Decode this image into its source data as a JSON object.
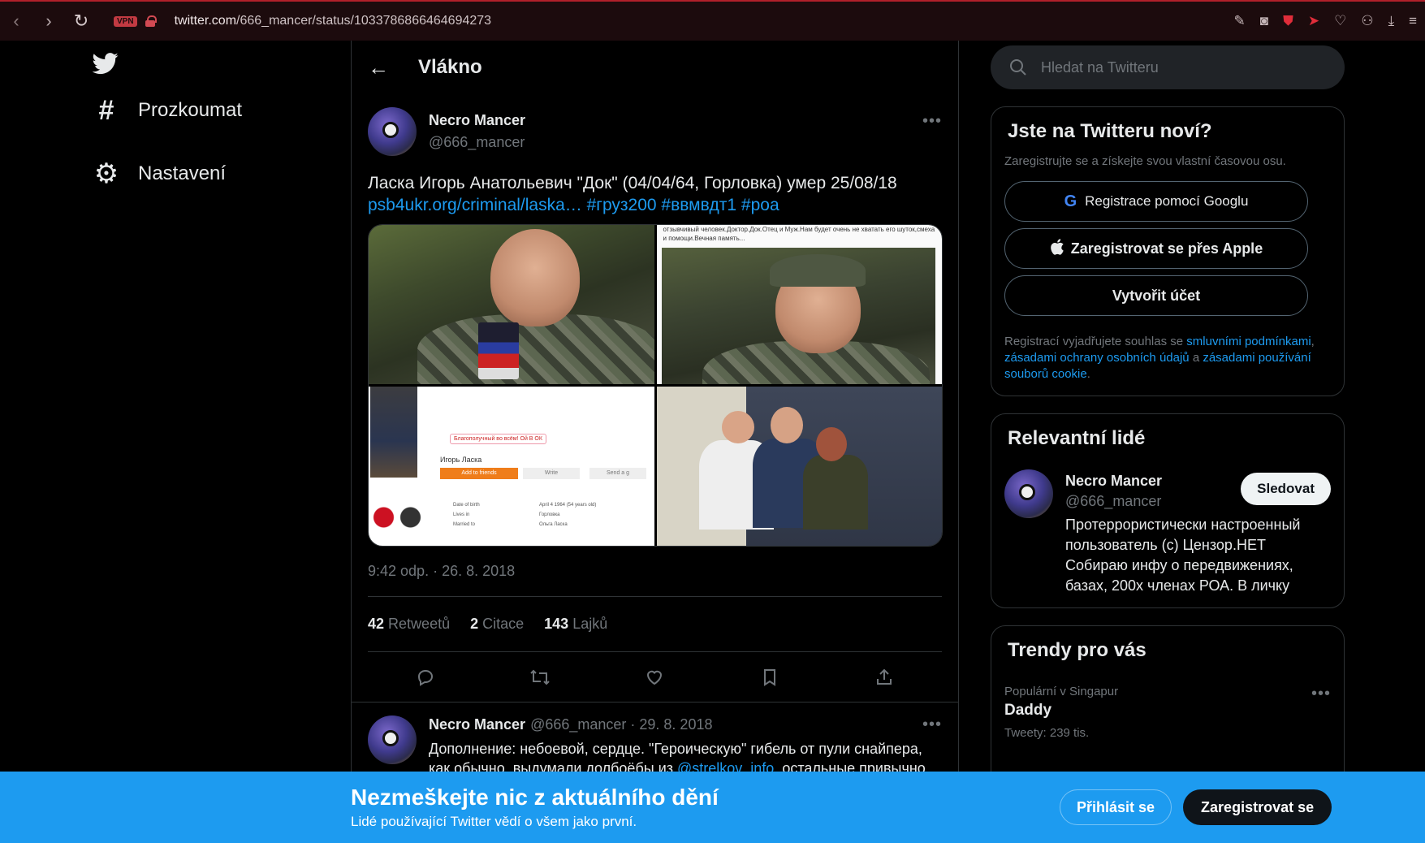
{
  "browser": {
    "vpn_label": "VPN",
    "url_host": "twitter.com",
    "url_path": "/666_mancer/status/1033786866464694273"
  },
  "nav": {
    "items": [
      {
        "label": "Prozkoumat",
        "icon": "hashtag-icon"
      },
      {
        "label": "Nastavení",
        "icon": "gear-icon"
      }
    ]
  },
  "main": {
    "title": "Vlákno"
  },
  "tweet": {
    "author_name": "Necro Mancer",
    "author_handle": "@666_mancer",
    "text": "Ласка Игорь Анатольевич \"Док\" (04/04/64, Горловка) умер 25/08/18",
    "link": "psb4ukr.org/criminal/laska…",
    "hashtags": "#груз200 #ввмвдт1 #роа",
    "media_caption_fragment": "отзывчивый человек.Доктор.Док.Отец и Муж.Нам будет очень не хватать его шуток,смеха и помощи.Вечная память...",
    "media_profile": {
      "badge": "Благополучный во всём! Ой В ОК",
      "name": "Игорь Ласка",
      "add_friends": "Add to friends",
      "write": "Write",
      "send": "Send a g",
      "fields": [
        "Date of birth",
        "Lives in",
        "Married to"
      ],
      "values": [
        "April 4 1964 (54 years old)",
        "Горловка",
        "Ольга Ласка"
      ]
    },
    "timestamp": "9:42 odp. · 26. 8. 2018",
    "stats": [
      {
        "count": "42",
        "label": "Retweetů"
      },
      {
        "count": "2",
        "label": "Citace"
      },
      {
        "count": "143",
        "label": "Lajků"
      }
    ]
  },
  "reply": {
    "author_name": "Necro Mancer",
    "meta": "@666_mancer · 29. 8. 2018",
    "text_line1": "Дополнение: небоевой, сердце. \"Героическую\" гибель от пули снайпера,",
    "text_line2_pre": "как обычно, выдумали долбоёбы из ",
    "text_line2_link": "@strelkov_info",
    "text_line2_post": ", остальные привычно"
  },
  "right": {
    "search_placeholder": "Hledat na Twitteru",
    "signup": {
      "title": "Jste na Twitteru noví?",
      "subtitle": "Zaregistrujte se a získejte svou vlastní časovou osu.",
      "google_btn": "Registrace pomocí Googlu",
      "apple_btn": "Zaregistrovat se přes Apple",
      "create_btn": "Vytvořit účet",
      "legal_pre": "Registrací vyjadřujete souhlas se ",
      "legal_link1": "smluvními podmínkami",
      "legal_mid": ", ",
      "legal_link2": "zásadami ochrany osobních údajů",
      "legal_and": " a ",
      "legal_link3": "zásadami používání souborů cookie",
      "legal_end": "."
    },
    "relevant": {
      "title": "Relevantní lidé",
      "name": "Necro Mancer",
      "handle": "@666_mancer",
      "follow": "Sledovat",
      "bio": "Протеррористически настроенный пользователь (c) Цензор.НЕТ Собираю инфу о передвижениях, базах, 200х членах РОА. В личку"
    },
    "trends": {
      "title": "Trendy pro vás",
      "location": "Populární v Singapur",
      "name": "Daddy",
      "count": "Tweety: 239 tis."
    }
  },
  "banner": {
    "title": "Nezmeškejte nic z aktuálního dění",
    "subtitle": "Lidé používající Twitter vědí o všem jako první.",
    "login": "Přihlásit se",
    "register": "Zaregistrovat se"
  },
  "colors": {
    "accent": "#1d9bf0",
    "background": "#000000",
    "muted": "#71767b",
    "chrome": "#1c0b0d"
  }
}
